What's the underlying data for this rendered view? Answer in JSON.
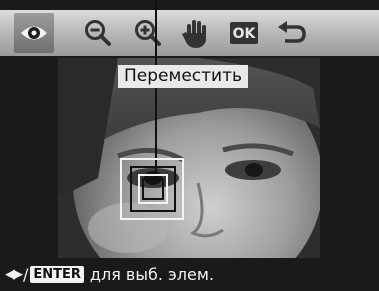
{
  "toolbar": {
    "items": [
      {
        "icon": "eye-icon",
        "state": "selected"
      },
      {
        "icon": "zoom-out-icon"
      },
      {
        "icon": "zoom-in-icon"
      },
      {
        "icon": "hand-move-icon"
      },
      {
        "icon": "ok-icon",
        "label": "OK"
      },
      {
        "icon": "return-icon"
      }
    ]
  },
  "overlay": {
    "move_label": "Переместить"
  },
  "hint": {
    "arrows": "◀▶",
    "slash": "/",
    "enter_label": "ENTER",
    "text": "для выб. элем."
  },
  "colors": {
    "toolbar_top": "#dcdcdc",
    "toolbar_bottom": "#9a9a9a",
    "selected": "#7a7a7a",
    "background": "#1a1a1a",
    "text": "#f2f2f2"
  }
}
